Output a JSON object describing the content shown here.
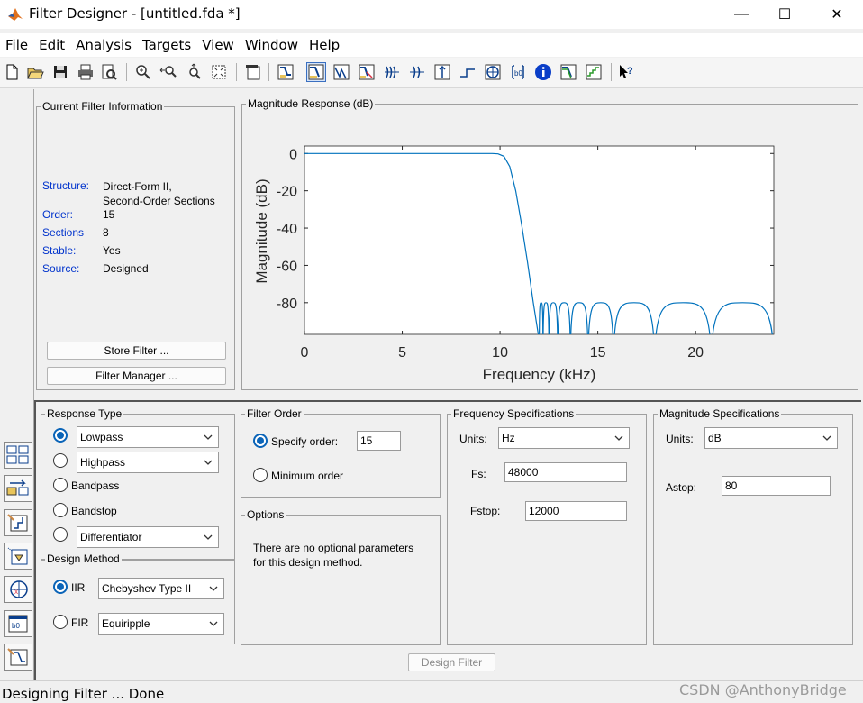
{
  "window": {
    "title": "Filter Designer -  [untitled.fda *]",
    "minimize": "—",
    "maximize": "☐",
    "close": "✕"
  },
  "menu": [
    "File",
    "Edit",
    "Analysis",
    "Targets",
    "View",
    "Window",
    "Help"
  ],
  "toolbar": {
    "icons": [
      "new-icon",
      "open-icon",
      "save-icon",
      "print-icon",
      "print-preview-icon",
      "zoom-in-icon",
      "zoom-x-icon",
      "zoom-y-icon",
      "full-view-icon",
      "new-window-icon",
      "filter-specs-icon",
      "magnitude-response-icon",
      "phase-response-icon",
      "mag-phase-icon",
      "group-delay-icon",
      "phase-delay-icon",
      "impulse-response-icon",
      "step-response-icon",
      "pole-zero-icon",
      "coefficients-icon",
      "info-icon",
      "magnitude-estimate-icon",
      "noise-power-icon",
      "whats-this-icon"
    ],
    "active": "magnitude-response-icon"
  },
  "current_filter": {
    "title": "Current Filter Information",
    "fields": [
      {
        "label": "Structure:",
        "value": "Direct-Form II,\nSecond-Order Sections"
      },
      {
        "label": "Order:",
        "value": "15"
      },
      {
        "label": "Sections",
        "value": "8"
      },
      {
        "label": "Stable:",
        "value": "Yes"
      },
      {
        "label": "Source:",
        "value": "Designed"
      }
    ],
    "store_button": "Store Filter ...",
    "manager_button": "Filter Manager ..."
  },
  "plot_panel": {
    "title": "Magnitude Response (dB)"
  },
  "chart_data": {
    "type": "line",
    "xlabel": "Frequency (kHz)",
    "ylabel": "Magnitude (dB)",
    "xlim": [
      0,
      24
    ],
    "ylim": [
      -97,
      4
    ],
    "xticks": [
      "0",
      "5",
      "10",
      "15",
      "20"
    ],
    "yticks": [
      "0",
      "-20",
      "-40",
      "-60",
      "-80"
    ],
    "series": [
      {
        "color": "#0072bd",
        "x": [
          0,
          9.6,
          9.9,
          10.2,
          10.5,
          10.8,
          11.1,
          11.4,
          11.7,
          12.0
        ],
        "y": [
          0,
          0,
          -0.2,
          -1.5,
          -7,
          -20,
          -38,
          -58,
          -80,
          -100
        ]
      }
    ],
    "stopband_lobes": [
      {
        "x0": 12.0,
        "x1": 12.2,
        "peak": -80
      },
      {
        "x0": 12.2,
        "x1": 12.5,
        "peak": -80
      },
      {
        "x0": 12.5,
        "x1": 12.95,
        "peak": -80
      },
      {
        "x0": 12.95,
        "x1": 13.6,
        "peak": -80
      },
      {
        "x0": 13.6,
        "x1": 14.5,
        "peak": -80
      },
      {
        "x0": 14.5,
        "x1": 15.8,
        "peak": -80
      },
      {
        "x0": 15.8,
        "x1": 17.9,
        "peak": -80
      },
      {
        "x0": 17.9,
        "x1": 20.8,
        "peak": -80
      },
      {
        "x0": 20.8,
        "x1": 24.0,
        "peak": -80
      }
    ],
    "grid": false
  },
  "response_type": {
    "title": "Response Type",
    "options": [
      {
        "label": "Lowpass",
        "kind": "dropdown",
        "selected": true
      },
      {
        "label": "Highpass",
        "kind": "dropdown",
        "selected": false
      },
      {
        "label": "Bandpass",
        "kind": "plain",
        "selected": false
      },
      {
        "label": "Bandstop",
        "kind": "plain",
        "selected": false
      },
      {
        "label": "Differentiator",
        "kind": "dropdown",
        "selected": false
      }
    ]
  },
  "design_method": {
    "title": "Design Method",
    "iir_label": "IIR",
    "iir_value": "Chebyshev Type II",
    "fir_label": "FIR",
    "fir_value": "Equiripple",
    "selected": "IIR"
  },
  "filter_order": {
    "title": "Filter Order",
    "specify_label": "Specify order:",
    "specify_value": "15",
    "minimum_label": "Minimum order",
    "selected": "specify"
  },
  "options": {
    "title": "Options",
    "text": "There are no optional parameters\nfor this design method."
  },
  "freq_specs": {
    "title": "Frequency Specifications",
    "units_label": "Units:",
    "units_value": "Hz",
    "fs_label": "Fs:",
    "fs_value": "48000",
    "fstop_label": "Fstop:",
    "fstop_value": "12000"
  },
  "mag_specs": {
    "title": "Magnitude Specifications",
    "units_label": "Units:",
    "units_value": "dB",
    "astop_label": "Astop:",
    "astop_value": "80"
  },
  "design_button": "Design Filter",
  "status": "Designing Filter ... Done",
  "watermark": "CSDN @AnthonyBridge",
  "side_icons": [
    "transform-icon",
    "convert-structure-icon",
    "pole-zero-editor-icon",
    "import-filter-icon",
    "multirate-icon",
    "realize-model-icon",
    "design-filter-icon"
  ]
}
